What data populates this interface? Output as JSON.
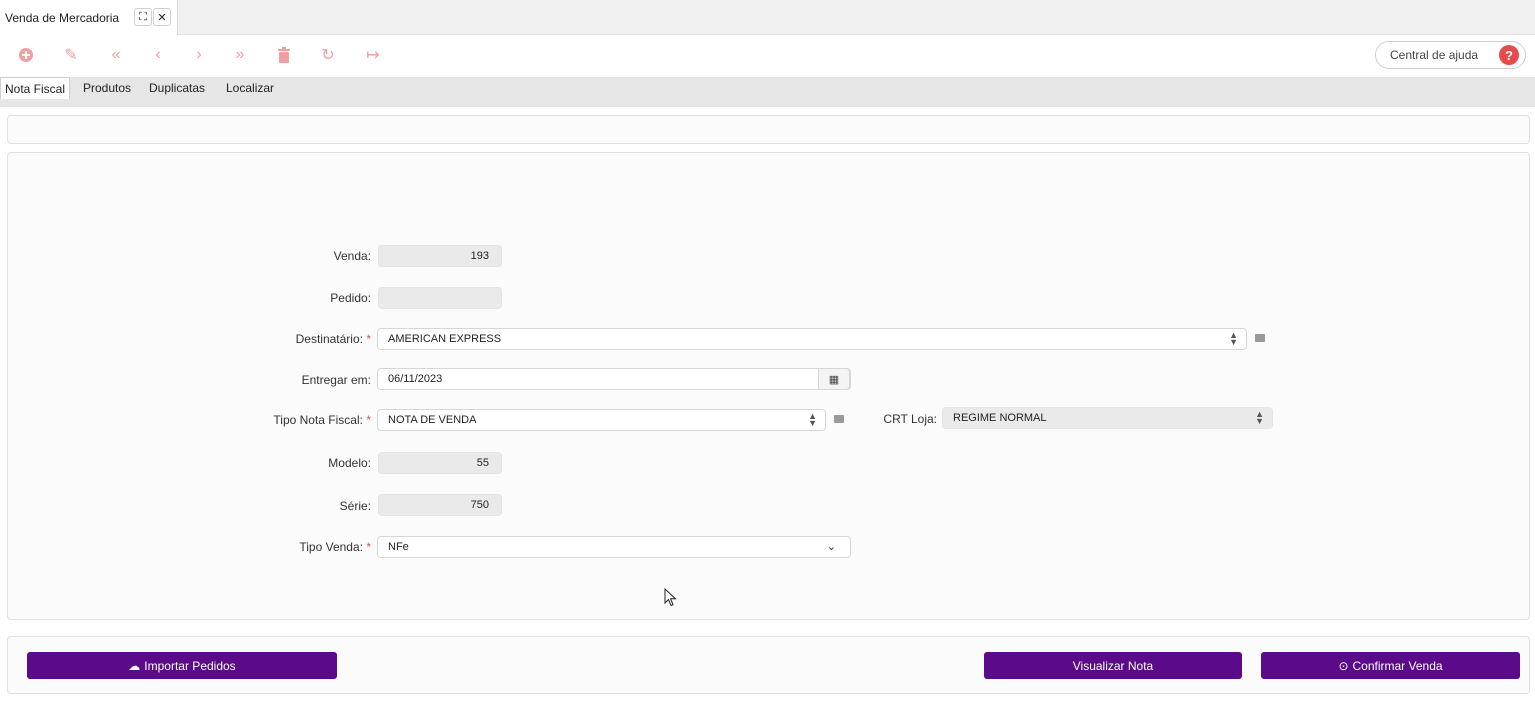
{
  "window": {
    "tab_title": "Venda de Mercadoria",
    "expand_icon": "expand-icon",
    "close_icon": "close-icon"
  },
  "toolbar": {
    "icons": [
      "add-icon",
      "edit-icon",
      "first-icon",
      "previous-icon",
      "next-icon",
      "last-icon",
      "delete-icon",
      "refresh-icon",
      "exit-icon"
    ],
    "icon_color": "#f0a0a0",
    "help_label": "Central de ajuda",
    "help_glyph": "?"
  },
  "tabs": [
    {
      "label": "Nota Fiscal",
      "active": true
    },
    {
      "label": "Produtos",
      "active": false
    },
    {
      "label": "Duplicatas",
      "active": false
    },
    {
      "label": "Localizar",
      "active": false
    }
  ],
  "form": {
    "venda": {
      "label": "Venda:",
      "value": "193"
    },
    "pedido": {
      "label": "Pedido:",
      "value": ""
    },
    "destinatario": {
      "label": "Destinatário:",
      "required": "*",
      "value": "AMERICAN EXPRESS"
    },
    "entregar_em": {
      "label": "Entregar em:",
      "value": "06/11/2023"
    },
    "tipo_nota": {
      "label": "Tipo Nota Fiscal:",
      "required": "*",
      "value": "NOTA DE VENDA"
    },
    "crt_loja": {
      "label": "CRT Loja:",
      "value": "REGIME NORMAL"
    },
    "modelo": {
      "label": "Modelo:",
      "value": "55"
    },
    "serie": {
      "label": "Série:",
      "value": "750"
    },
    "tipo_venda": {
      "label": "Tipo Venda:",
      "required": "*",
      "value": "NFe"
    }
  },
  "actions": {
    "importar": "Importar Pedidos",
    "visualizar": "Visualizar Nota",
    "confirmar": "Confirmar Venda",
    "color": "#5b0a8a"
  }
}
